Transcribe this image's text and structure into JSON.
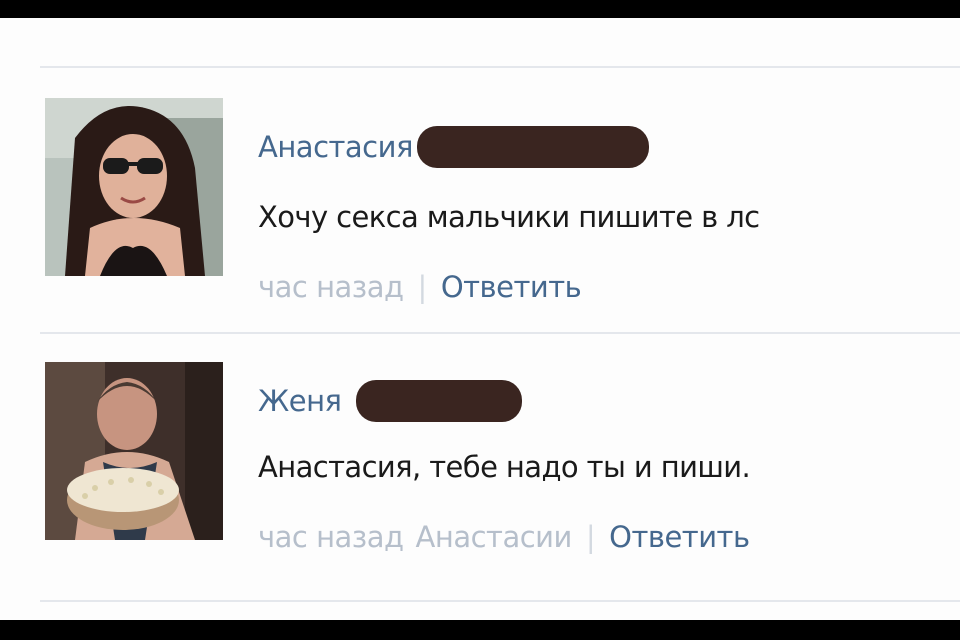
{
  "comments": [
    {
      "author": "Анастасия",
      "text": "Хочу секса мальчики пишите в лс",
      "time": "час назад",
      "reply_to": "",
      "reply_label": "Ответить",
      "separator": "|"
    },
    {
      "author": "Женя",
      "text": "Анастасия, тебе надо ты и пиши.",
      "time": "час назад",
      "reply_to": "Анастасии",
      "reply_label": "Ответить",
      "separator": "|"
    }
  ],
  "colors": {
    "author_link": "#45688e",
    "meta_gray": "#b6bfcb",
    "redaction": "#3a2520",
    "divider": "#e4e7ec"
  }
}
